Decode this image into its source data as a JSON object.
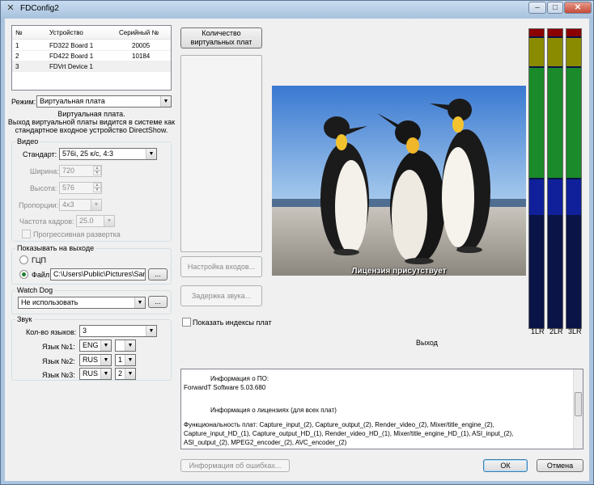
{
  "window": {
    "title": "FDConfig2",
    "minimize_icon": "minimize-icon",
    "maximize_icon": "maximize-icon",
    "close_icon": "close-icon"
  },
  "devices": {
    "headers": [
      "№",
      "Устройство",
      "Серийный №"
    ],
    "rows": [
      {
        "n": "1",
        "device": "FD322 Board 1",
        "serial": "20005"
      },
      {
        "n": "2",
        "device": "FD422 Board 1",
        "serial": "10184"
      },
      {
        "n": "3",
        "device": "FDVrt Device 1",
        "serial": ""
      }
    ]
  },
  "mode": {
    "label": "Режим:",
    "value": "Виртуальная плата",
    "description": [
      "Виртуальная плата.",
      "Выход виртуальной платы видится в системе как",
      "стандартное входное устройство DirectShow."
    ]
  },
  "video": {
    "group": "Видео",
    "standard_label": "Стандарт:",
    "standard_value": "576i, 25 к/с, 4:3",
    "width_label": "Ширина:",
    "width_value": "720",
    "height_label": "Высота:",
    "height_value": "576",
    "aspect_label": "Пропорции:",
    "aspect_value": "4x3",
    "fps_label": "Частота кадров:",
    "fps_value": "25.0",
    "progressive_label": "Прогрессивная развертка"
  },
  "output": {
    "group": "Показывать на выходе",
    "gcp_label": "ГЦП",
    "file_label": "Файл:",
    "file_value": "C:\\Users\\Public\\Pictures\\Sampl",
    "browse_label": "..."
  },
  "watchdog": {
    "group": "Watch Dog",
    "value": "Не использовать",
    "browse_label": "..."
  },
  "sound": {
    "group": "Звук",
    "count_label": "Кол-во языков:",
    "count_value": "3",
    "lang1_label": "Язык №1:",
    "lang1_value": "ENG",
    "lang1_ch": "",
    "lang2_label": "Язык №2:",
    "lang2_value": "RUS",
    "lang2_ch": "1",
    "lang3_label": "Язык №3:",
    "lang3_value": "RUS",
    "lang3_ch": "2"
  },
  "buttons": {
    "virtual_count": "Количество виртуальных плат",
    "inputs_setup": "Настройка входов...",
    "sound_delay": "Задержка звука...",
    "errors_info": "Информация об ошибках...",
    "ok": "ОК",
    "cancel": "Отмена"
  },
  "show_indexes_label": "Показать индексы плат",
  "preview": {
    "caption": "Лицензия присутствует",
    "output_label": "Выход"
  },
  "meters": {
    "labels": [
      "1LR",
      "2LR",
      "3LR"
    ],
    "colors": {
      "red": "#8b0000",
      "olive": "#8b8b00",
      "green": "#1a8a2a",
      "blue": "#10209a",
      "navy": "#0a1446"
    }
  },
  "info": {
    "lines": [
      "Информация о ПО:",
      "ForwardT Software 5.03.680",
      "",
      "Информация о лицензиях (для всех плат)",
      "",
      "Функциональность плат: Capture_input_(2), Capture_output_(2), Render_video_(2), Mixer/title_engine_(2),",
      "Capture_input_HD_(1), Capture_output_HD_(1), Render_video_HD_(1), Mixer/title_engine_HD_(1), ASI_input_(2),",
      "ASI_output_(2), MPEG2_encoder_(2), AVC_encoder_(2)"
    ]
  }
}
